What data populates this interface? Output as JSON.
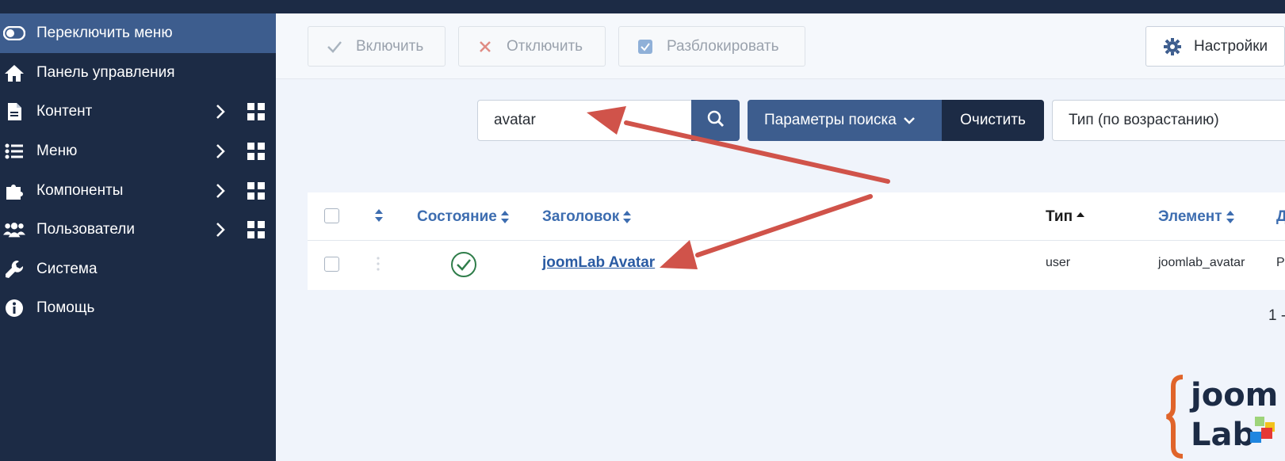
{
  "sidebar": {
    "toggle_label": "Переключить меню",
    "items": [
      {
        "label": "Панель управления"
      },
      {
        "label": "Контент"
      },
      {
        "label": "Меню"
      },
      {
        "label": "Компоненты"
      },
      {
        "label": "Пользователи"
      },
      {
        "label": "Система"
      },
      {
        "label": "Помощь"
      }
    ]
  },
  "toolbar": {
    "enable_label": "Включить",
    "disable_label": "Отключить",
    "unlock_label": "Разблокировать",
    "settings_label": "Настройки"
  },
  "search": {
    "value": "avatar",
    "params_label": "Параметры поиска",
    "clear_label": "Очистить",
    "sort_value": "Тип (по возрастанию)"
  },
  "table": {
    "headers": {
      "state": "Состояние",
      "title": "Заголовок",
      "type": "Тип",
      "element": "Элемент",
      "extra": "Д"
    },
    "rows": [
      {
        "title": "joomLab Avatar",
        "type": "user",
        "element": "joomlab_avatar",
        "extra": "P",
        "state": "enabled"
      }
    ]
  },
  "pagination": {
    "text": "1 -"
  },
  "logo": {
    "line1": "joom",
    "line2": "Lab"
  },
  "colors": {
    "sidebar_bg": "#1c2b45",
    "accent": "#3d5d8e",
    "link": "#2a5ba3",
    "arrow": "#d0534a",
    "success": "#2f7d4a"
  }
}
